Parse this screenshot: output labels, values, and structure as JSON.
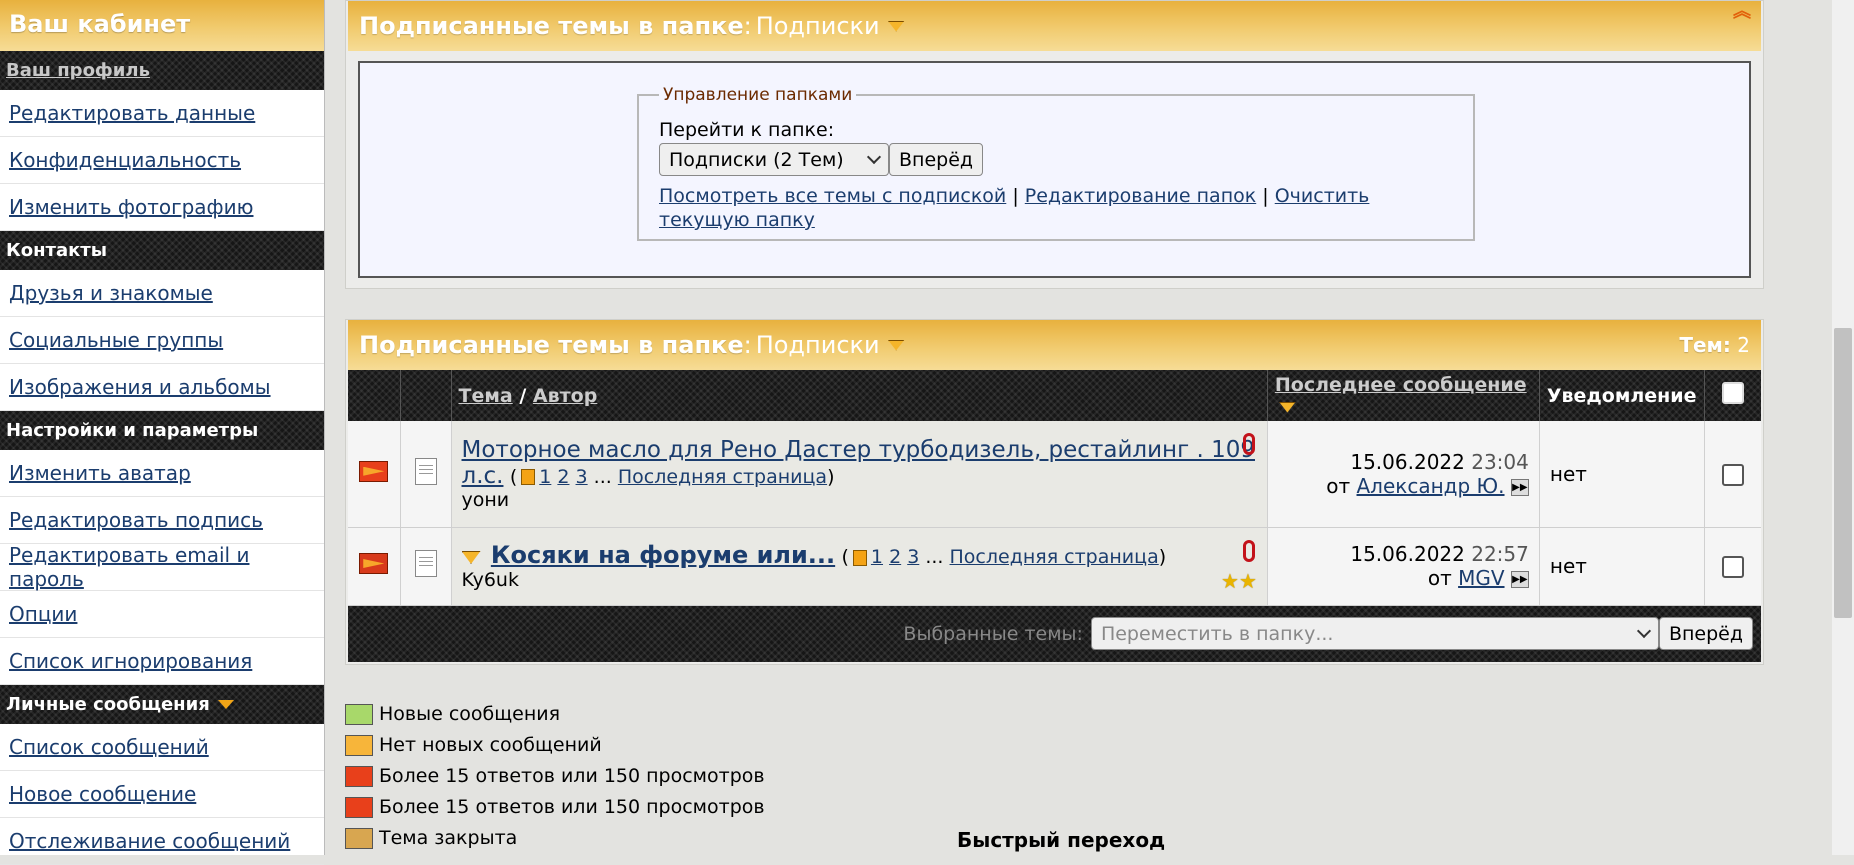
{
  "sidebar": {
    "title": "Ваш кабинет",
    "sections": [
      {
        "heading": "Ваш профиль",
        "items": [
          "Редактировать данные",
          "Конфиденциальность",
          "Изменить фотографию"
        ]
      },
      {
        "heading": "Контакты",
        "items": [
          "Друзья и знакомые",
          "Социальные группы",
          "Изображения и альбомы"
        ]
      },
      {
        "heading": "Настройки и параметры",
        "items": [
          "Изменить аватар",
          "Редактировать подпись",
          "Редактировать email и пароль",
          "Опции",
          "Список игнорирования"
        ]
      },
      {
        "heading": "Личные сообщения",
        "items": [
          "Список сообщений",
          "Новое сообщение",
          "Отслеживание сообщений"
        ]
      }
    ]
  },
  "folder_block": {
    "title": "Подписанные темы в папке",
    "folder": "Подписки",
    "legend": "Управление папками",
    "goto_label": "Перейти к папке:",
    "select_value": "Подписки (2 Тем)",
    "go_button": "Вперёд",
    "link_all": "Посмотреть все темы с подпиской",
    "link_edit": "Редактирование папок",
    "link_clear": "Очистить текущую папку",
    "sep": "|"
  },
  "threads_block": {
    "title": "Подписанные темы в папке",
    "folder": "Подписки",
    "count_label": "Тем:",
    "count_value": "2",
    "col_topic": "Тема",
    "col_sep": "/",
    "col_author": "Автор",
    "col_last": "Последнее сообщение",
    "col_notify": "Уведомление",
    "rows": [
      {
        "title": "Моторное масло для Рено Дастер турбодизель, рестайлинг . 109 л.с.",
        "p1": "1",
        "p2": "2",
        "p3": "3",
        "dots": "...",
        "last_page": "Последняя страница",
        "author": "уони",
        "date": "15.06.2022",
        "time": "23:04",
        "from": "от",
        "last_user": "Александр Ю.",
        "notify": "нет"
      },
      {
        "title": "Косяки на форуме или...",
        "p1": "1",
        "p2": "2",
        "p3": "3",
        "dots": "...",
        "last_page": "Последняя страница",
        "author": "Ky6uk",
        "date": "15.06.2022",
        "time": "22:57",
        "from": "от",
        "last_user": "MGV",
        "notify": "нет"
      }
    ],
    "selected_label": "Выбранные темы:",
    "move_select": "Переместить в папку...",
    "go_button": "Вперёд"
  },
  "legend": [
    {
      "text": "Новые сообщения",
      "color": "#a8d86a"
    },
    {
      "text": "Нет новых сообщений",
      "color": "#f7b53a"
    },
    {
      "text": "Более 15 ответов или 150 просмотров",
      "color": "#e8401b"
    },
    {
      "text": "Более 15 ответов или 150 просмотров",
      "color": "#e8401b"
    },
    {
      "text": "Тема закрыта",
      "color": "#d8a650"
    }
  ],
  "quick_nav": "Быстрый переход"
}
